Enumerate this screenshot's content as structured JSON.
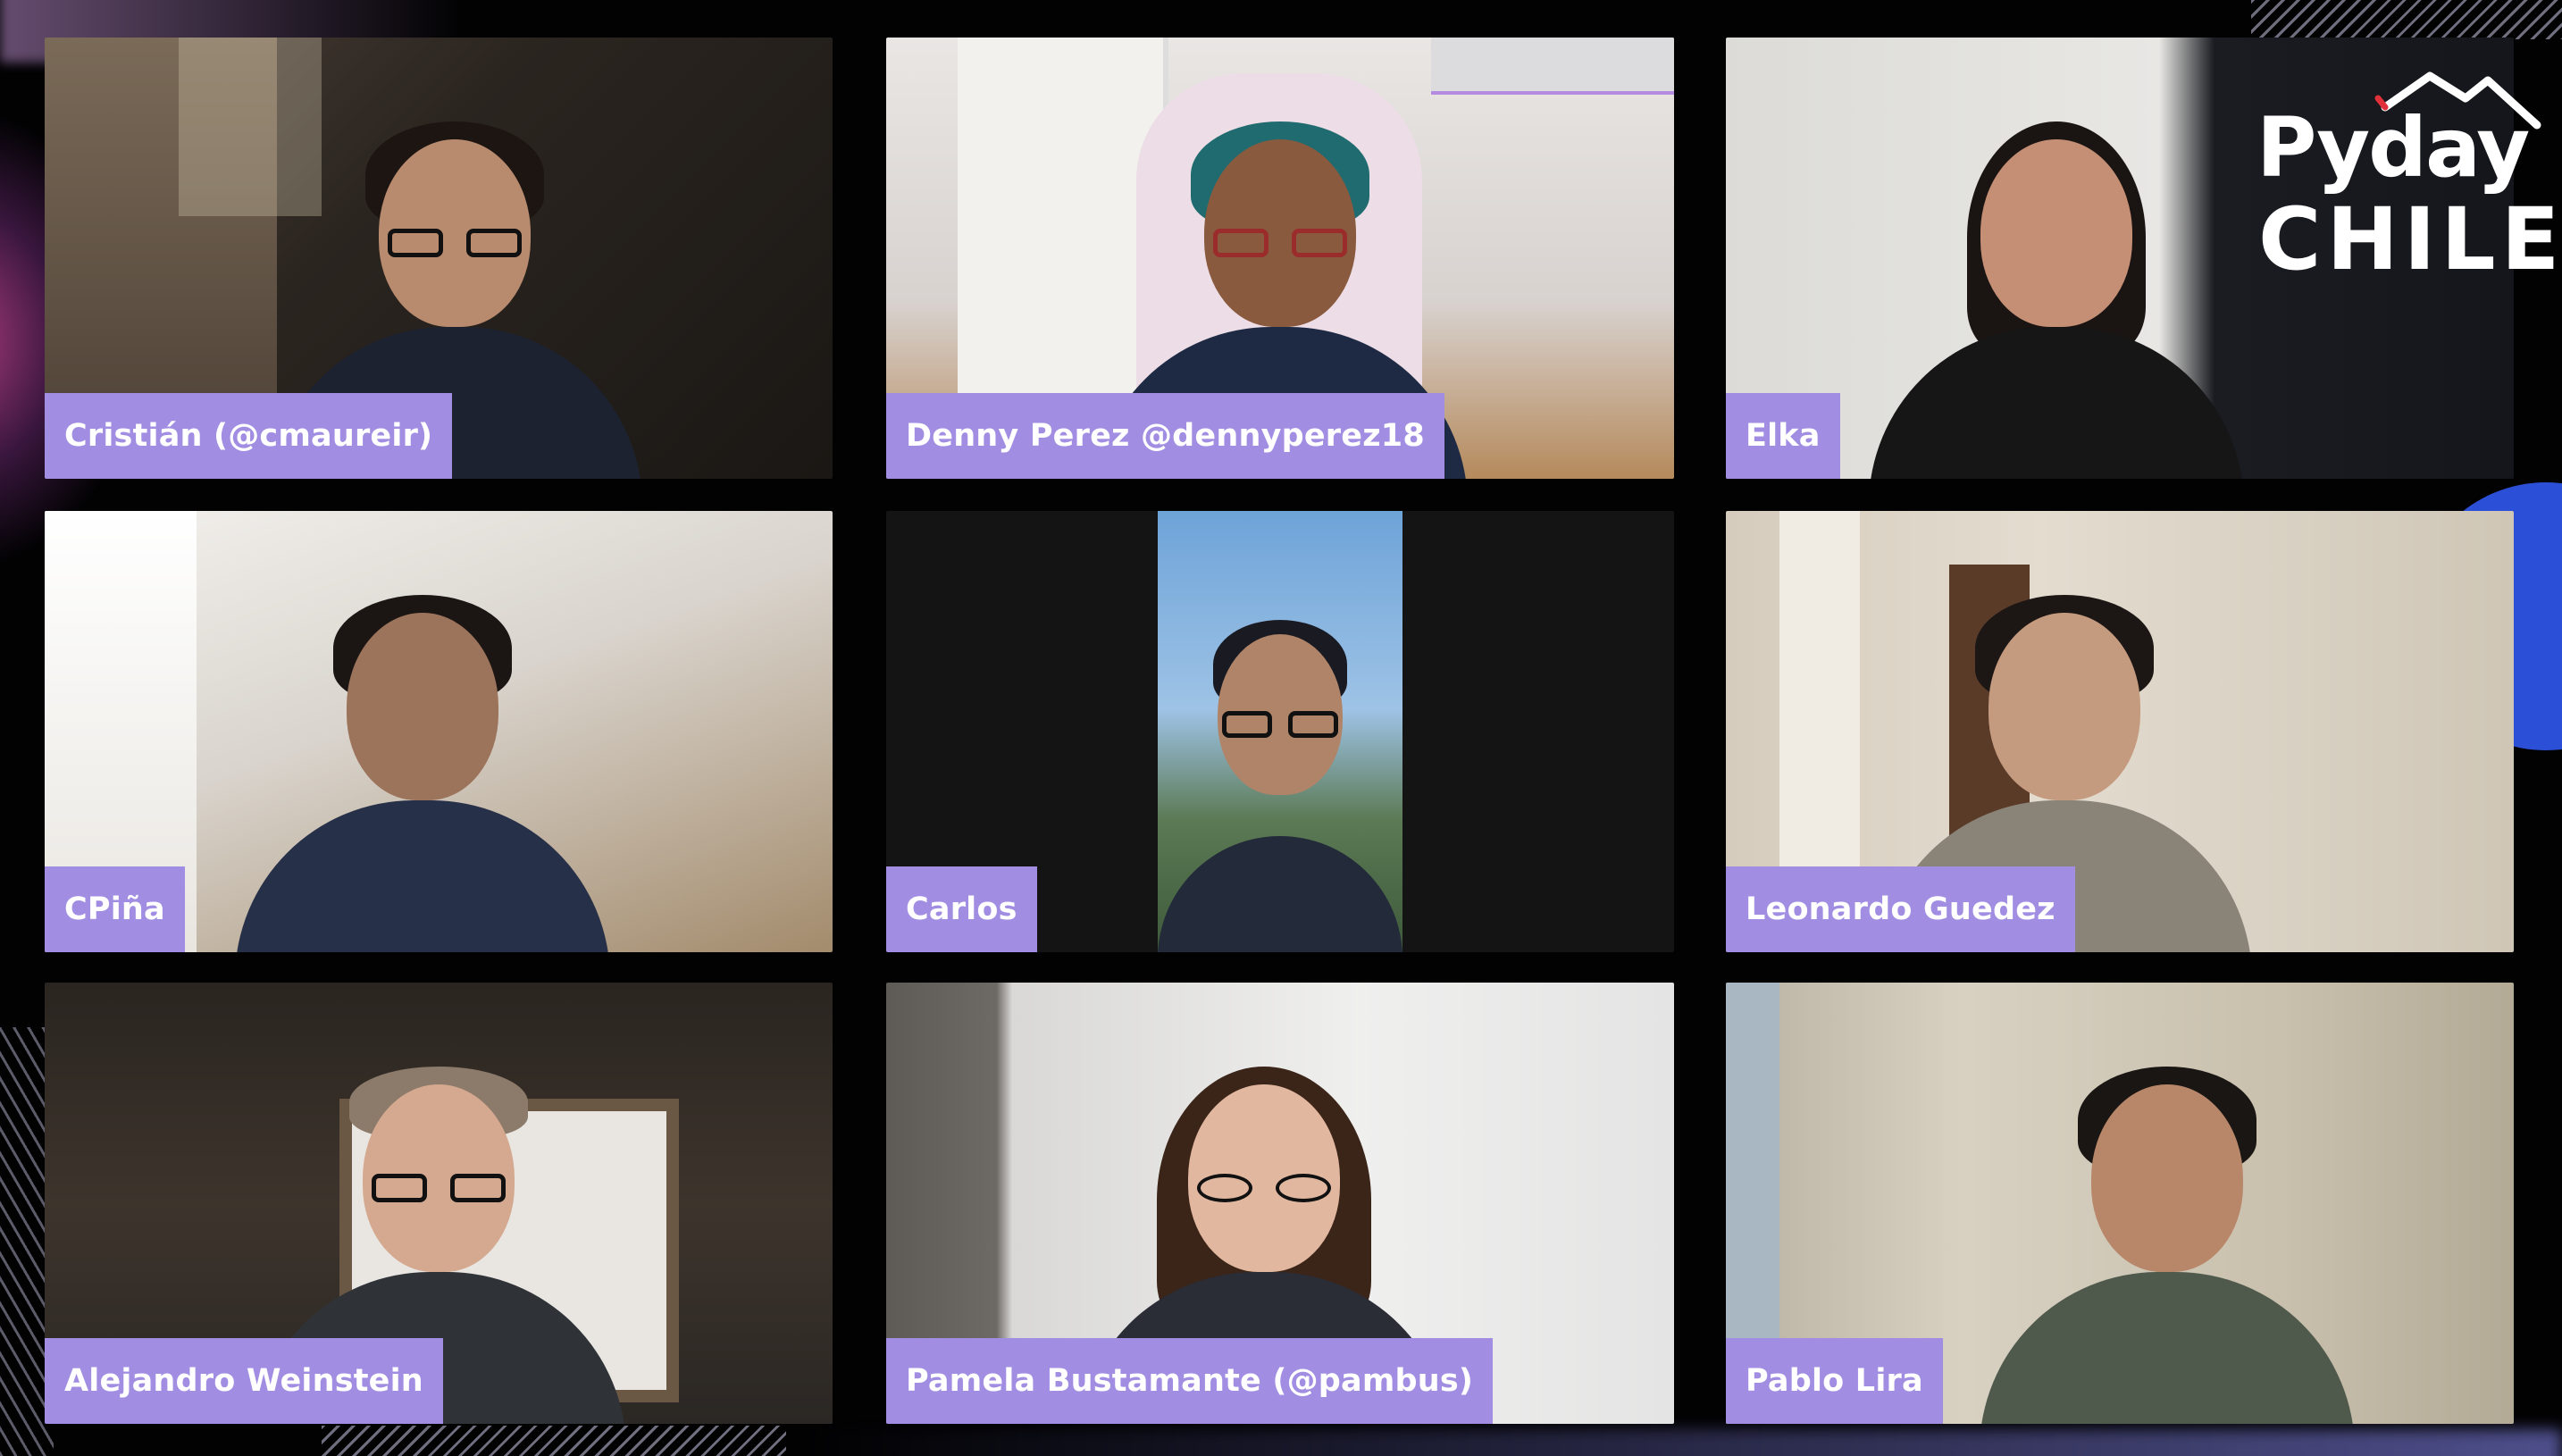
{
  "event": {
    "logo_line1": "Pyday",
    "logo_line2": "CHILE"
  },
  "colors": {
    "name_tag_bg": "#a18ee2",
    "name_tag_text": "#ffffff",
    "background": "#020203",
    "accent_blue": "#2b4fd6",
    "accent_pink": "#e650aa"
  },
  "participants": [
    {
      "name": "Cristián (@cmaureir)"
    },
    {
      "name": "Denny Perez @dennyperez18"
    },
    {
      "name": "Elka"
    },
    {
      "name": "CPiña"
    },
    {
      "name": "Carlos"
    },
    {
      "name": "Leonardo Guedez"
    },
    {
      "name": "Alejandro Weinstein"
    },
    {
      "name": "Pamela Bustamante (@pambus)"
    },
    {
      "name": "Pablo Lira"
    }
  ]
}
